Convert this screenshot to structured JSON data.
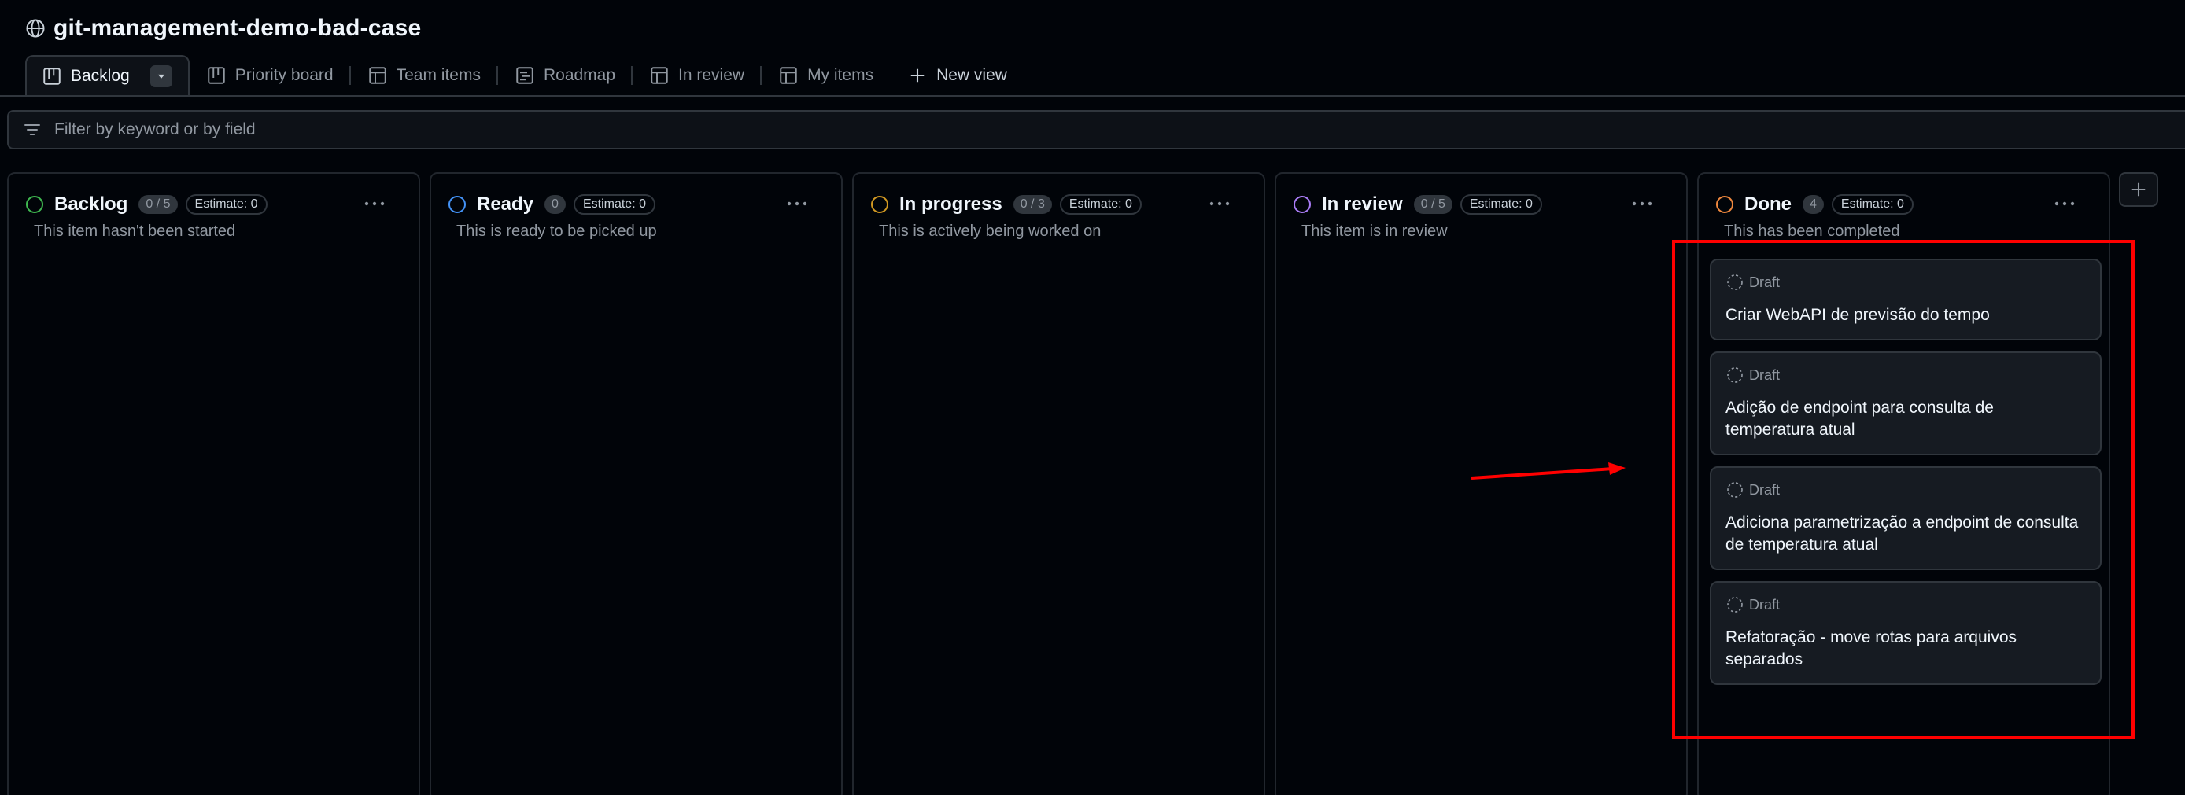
{
  "project": {
    "title": "git-management-demo-bad-case"
  },
  "tabs": [
    {
      "label": "Backlog",
      "icon": "board-icon",
      "active": true
    },
    {
      "label": "Priority board",
      "icon": "board-icon"
    },
    {
      "label": "Team items",
      "icon": "table-icon"
    },
    {
      "label": "Roadmap",
      "icon": "roadmap-icon"
    },
    {
      "label": "In review",
      "icon": "table-icon"
    },
    {
      "label": "My items",
      "icon": "table-icon"
    },
    {
      "label": "New view",
      "icon": "plus-icon"
    }
  ],
  "filter": {
    "placeholder": "Filter by keyword or by field"
  },
  "columns": [
    {
      "name": "Backlog",
      "count": "0 / 5",
      "estimate": "Estimate: 0",
      "description": "This item hasn't been started",
      "color": "#3fb950"
    },
    {
      "name": "Ready",
      "count": "0",
      "estimate": "Estimate: 0",
      "description": "This is ready to be picked up",
      "color": "#4493f8"
    },
    {
      "name": "In progress",
      "count": "0 / 3",
      "estimate": "Estimate: 0",
      "description": "This is actively being worked on",
      "color": "#d29922"
    },
    {
      "name": "In review",
      "count": "0 / 5",
      "estimate": "Estimate: 0",
      "description": "This item is in review",
      "color": "#ab7df8"
    },
    {
      "name": "Done",
      "count": "4",
      "estimate": "Estimate: 0",
      "description": "This has been completed",
      "color": "#f0883e",
      "cards": [
        {
          "type": "Draft",
          "title": "Criar WebAPI de previsão do tempo"
        },
        {
          "type": "Draft",
          "title": "Adição de endpoint para consulta de temperatura atual"
        },
        {
          "type": "Draft",
          "title": "Adiciona parametrização a endpoint de consulta de temperatura atual"
        },
        {
          "type": "Draft",
          "title": "Refatoração - move rotas para arquivos separados"
        }
      ]
    }
  ],
  "colors": {
    "background": "#010409",
    "annotation": "#ff0000"
  }
}
